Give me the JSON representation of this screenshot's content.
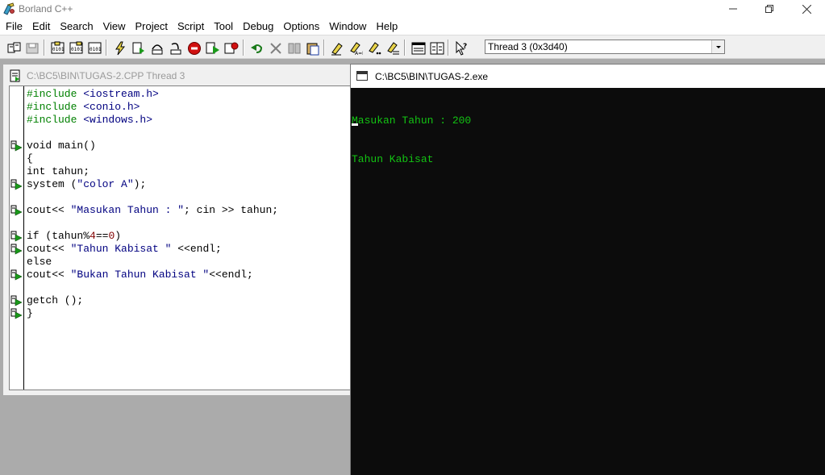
{
  "app": {
    "title": "Borland C++"
  },
  "menu": [
    "File",
    "Edit",
    "Search",
    "View",
    "Project",
    "Script",
    "Tool",
    "Debug",
    "Options",
    "Window",
    "Help"
  ],
  "toolbar": {
    "thread_select_value": "Thread 3 (0x3d40)"
  },
  "editor": {
    "title": "C:\\BC5\\BIN\\TUGAS-2.CPP Thread 3",
    "lines": [
      [
        {
          "t": "#include ",
          "c": "kw-green"
        },
        {
          "t": "<iostream.h>",
          "c": "kw-blue"
        }
      ],
      [
        {
          "t": "#include ",
          "c": "kw-green"
        },
        {
          "t": "<conio.h>",
          "c": "kw-blue"
        }
      ],
      [
        {
          "t": "#include ",
          "c": "kw-green"
        },
        {
          "t": "<windows.h>",
          "c": "kw-blue"
        }
      ],
      [],
      [
        {
          "t": "void main()",
          "c": ""
        }
      ],
      [
        {
          "t": "{",
          "c": ""
        }
      ],
      [
        {
          "t": "int tahun;",
          "c": ""
        }
      ],
      [
        {
          "t": "system (",
          "c": ""
        },
        {
          "t": "\"color A\"",
          "c": "str"
        },
        {
          "t": ");",
          "c": ""
        }
      ],
      [],
      [
        {
          "t": "cout<< ",
          "c": ""
        },
        {
          "t": "\"Masukan Tahun : \"",
          "c": "str"
        },
        {
          "t": "; cin >> tahun;",
          "c": ""
        }
      ],
      [],
      [
        {
          "t": "if (tahun%",
          "c": ""
        },
        {
          "t": "4",
          "c": "num"
        },
        {
          "t": "==",
          "c": ""
        },
        {
          "t": "0",
          "c": "num"
        },
        {
          "t": ")",
          "c": ""
        }
      ],
      [
        {
          "t": "cout<< ",
          "c": ""
        },
        {
          "t": "\"Tahun Kabisat \"",
          "c": "str"
        },
        {
          "t": " <<endl;",
          "c": ""
        }
      ],
      [
        {
          "t": "else",
          "c": ""
        }
      ],
      [
        {
          "t": "cout<< ",
          "c": ""
        },
        {
          "t": "\"Bukan Tahun Kabisat \"",
          "c": "str"
        },
        {
          "t": "<<endl;",
          "c": ""
        }
      ],
      [],
      [
        {
          "t": "getch ();",
          "c": ""
        }
      ],
      [
        {
          "t": "}",
          "c": ""
        }
      ]
    ],
    "breakpoint_lines": [
      4,
      7,
      9,
      11,
      12,
      14,
      16,
      17
    ]
  },
  "console": {
    "title": "C:\\BC5\\BIN\\TUGAS-2.exe",
    "lines": [
      "Masukan Tahun : 200",
      "Tahun Kabisat"
    ],
    "text_color": "#13c313",
    "background": "#0c0c0c"
  }
}
